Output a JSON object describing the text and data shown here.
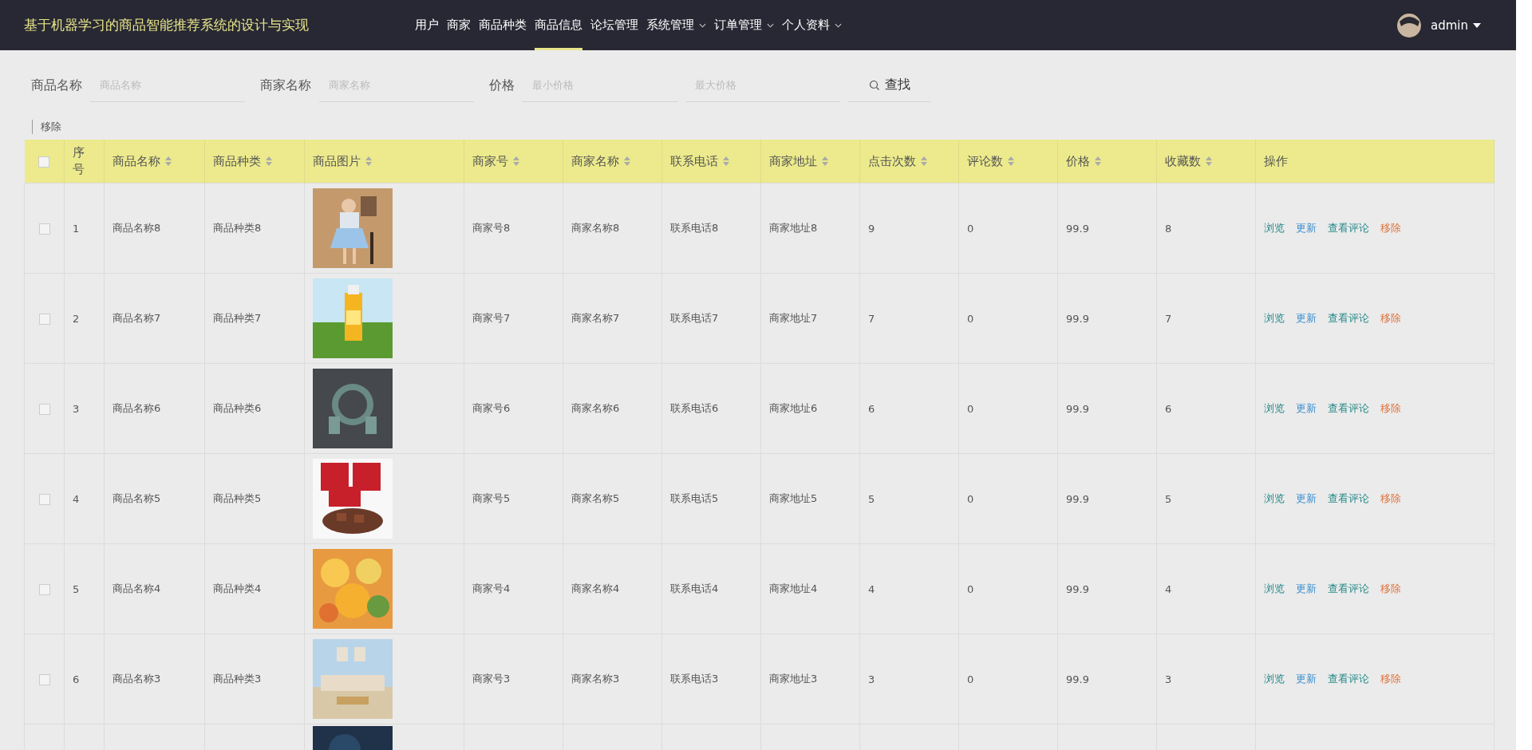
{
  "header": {
    "title": "基于机器学习的商品智能推荐系统的设计与实现",
    "nav": [
      {
        "label": "用户",
        "selected": false,
        "dropdown": false
      },
      {
        "label": "商家",
        "selected": false,
        "dropdown": false
      },
      {
        "label": "商品种类",
        "selected": false,
        "dropdown": false
      },
      {
        "label": "商品信息",
        "selected": true,
        "dropdown": false
      },
      {
        "label": "论坛管理",
        "selected": false,
        "dropdown": false
      },
      {
        "label": "系统管理",
        "selected": false,
        "dropdown": true
      },
      {
        "label": "订单管理",
        "selected": false,
        "dropdown": true
      },
      {
        "label": "个人资料",
        "selected": false,
        "dropdown": true
      }
    ],
    "user": "admin"
  },
  "search": {
    "fields": [
      {
        "label": "商品名称",
        "placeholder": "商品名称"
      },
      {
        "label": "商家名称",
        "placeholder": "商家名称"
      },
      {
        "label": "价格",
        "placeholder": "最小价格"
      },
      {
        "placeholder": "最大价格"
      }
    ],
    "button": "查找"
  },
  "bulk_action": "移除",
  "table": {
    "columns": [
      {
        "label": "序号",
        "sortable": false
      },
      {
        "label": "商品名称",
        "sortable": true
      },
      {
        "label": "商品种类",
        "sortable": true
      },
      {
        "label": "商品图片",
        "sortable": true
      },
      {
        "label": "商家号",
        "sortable": true
      },
      {
        "label": "商家名称",
        "sortable": true
      },
      {
        "label": "联系电话",
        "sortable": true
      },
      {
        "label": "商家地址",
        "sortable": true
      },
      {
        "label": "点击次数",
        "sortable": true
      },
      {
        "label": "评论数",
        "sortable": true
      },
      {
        "label": "价格",
        "sortable": true
      },
      {
        "label": "收藏数",
        "sortable": true
      },
      {
        "label": "操作",
        "sortable": false
      }
    ],
    "header_checked": false,
    "rows": [
      {
        "checked": false,
        "actions": [
          {
            "label": "浏览",
            "kind": "view"
          },
          {
            "label": "更新",
            "kind": "edit"
          },
          {
            "label": "查看评论",
            "kind": "comments"
          },
          {
            "label": "移除",
            "kind": "delete"
          }
        ],
        "cells": [
          "1",
          "商品名称8",
          "商品种类8",
          null,
          "商家号8",
          "商家名称8",
          "联系电话8",
          "商家地址8",
          "9",
          "0",
          "99.9",
          "8"
        ]
      },
      {
        "checked": false,
        "actions": [
          {
            "label": "浏览",
            "kind": "view"
          },
          {
            "label": "更新",
            "kind": "edit"
          },
          {
            "label": "查看评论",
            "kind": "comments"
          },
          {
            "label": "移除",
            "kind": "delete"
          }
        ],
        "cells": [
          "2",
          "商品名称7",
          "商品种类7",
          null,
          "商家号7",
          "商家名称7",
          "联系电话7",
          "商家地址7",
          "7",
          "0",
          "99.9",
          "7"
        ]
      },
      {
        "checked": false,
        "actions": [
          {
            "label": "浏览",
            "kind": "view"
          },
          {
            "label": "更新",
            "kind": "edit"
          },
          {
            "label": "查看评论",
            "kind": "comments"
          },
          {
            "label": "移除",
            "kind": "delete"
          }
        ],
        "cells": [
          "3",
          "商品名称6",
          "商品种类6",
          null,
          "商家号6",
          "商家名称6",
          "联系电话6",
          "商家地址6",
          "6",
          "0",
          "99.9",
          "6"
        ]
      },
      {
        "checked": false,
        "actions": [
          {
            "label": "浏览",
            "kind": "view"
          },
          {
            "label": "更新",
            "kind": "edit"
          },
          {
            "label": "查看评论",
            "kind": "comments"
          },
          {
            "label": "移除",
            "kind": "delete"
          }
        ],
        "cells": [
          "4",
          "商品名称5",
          "商品种类5",
          null,
          "商家号5",
          "商家名称5",
          "联系电话5",
          "商家地址5",
          "5",
          "0",
          "99.9",
          "5"
        ]
      },
      {
        "checked": false,
        "actions": [
          {
            "label": "浏览",
            "kind": "view"
          },
          {
            "label": "更新",
            "kind": "edit"
          },
          {
            "label": "查看评论",
            "kind": "comments"
          },
          {
            "label": "移除",
            "kind": "delete"
          }
        ],
        "cells": [
          "5",
          "商品名称4",
          "商品种类4",
          null,
          "商家号4",
          "商家名称4",
          "联系电话4",
          "商家地址4",
          "4",
          "0",
          "99.9",
          "4"
        ]
      },
      {
        "checked": false,
        "actions": [
          {
            "label": "浏览",
            "kind": "view"
          },
          {
            "label": "更新",
            "kind": "edit"
          },
          {
            "label": "查看评论",
            "kind": "comments"
          },
          {
            "label": "移除",
            "kind": "delete"
          }
        ],
        "cells": [
          "6",
          "商品名称3",
          "商品种类3",
          null,
          "商家号3",
          "商家名称3",
          "联系电话3",
          "商家地址3",
          "3",
          "0",
          "99.9",
          "3"
        ]
      }
    ]
  }
}
